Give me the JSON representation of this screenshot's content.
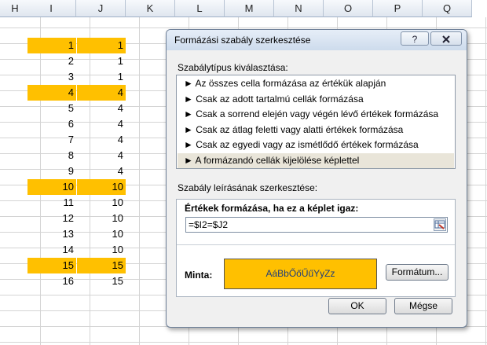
{
  "spreadsheet": {
    "columns": [
      "H",
      "I",
      "J",
      "K",
      "L",
      "M",
      "N",
      "O",
      "P",
      "Q"
    ],
    "rows": [
      {
        "i": "",
        "j": "",
        "highlight": false
      },
      {
        "i": "1",
        "j": "1",
        "highlight": true
      },
      {
        "i": "2",
        "j": "1",
        "highlight": false
      },
      {
        "i": "3",
        "j": "1",
        "highlight": false
      },
      {
        "i": "4",
        "j": "4",
        "highlight": true
      },
      {
        "i": "5",
        "j": "4",
        "highlight": false
      },
      {
        "i": "6",
        "j": "4",
        "highlight": false
      },
      {
        "i": "7",
        "j": "4",
        "highlight": false
      },
      {
        "i": "8",
        "j": "4",
        "highlight": false
      },
      {
        "i": "9",
        "j": "4",
        "highlight": false
      },
      {
        "i": "10",
        "j": "10",
        "highlight": true
      },
      {
        "i": "11",
        "j": "10",
        "highlight": false
      },
      {
        "i": "12",
        "j": "10",
        "highlight": false
      },
      {
        "i": "13",
        "j": "10",
        "highlight": false
      },
      {
        "i": "14",
        "j": "10",
        "highlight": false
      },
      {
        "i": "15",
        "j": "15",
        "highlight": true
      },
      {
        "i": "16",
        "j": "15",
        "highlight": false
      }
    ],
    "highlight_color": "#ffc000"
  },
  "dialog": {
    "title": "Formázási szabály szerkesztése",
    "help_label": "?",
    "close_label": "X",
    "rule_type_label": "Szabálytípus kiválasztása:",
    "rule_types": [
      "► Az összes cella formázása az értékük alapján",
      "► Csak az adott tartalmú cellák formázása",
      "► Csak a sorrend elején vagy végén lévő értékek formázása",
      "► Csak az átlag feletti vagy alatti értékek formázása",
      "► Csak az egyedi vagy az ismétlődő értékek formázása",
      "► A formázandó cellák kijelölése képlettel"
    ],
    "selected_rule_index": 5,
    "description_label": "Szabály leírásának szerkesztése:",
    "formula_label": "Értékek formázása, ha ez a képlet igaz:",
    "formula_value": "=$I2=$J2",
    "preview_label": "Minta:",
    "preview_text": "AáBbŐőŰűYyZz",
    "format_button": "Formátum...",
    "ok_button": "OK",
    "cancel_button": "Mégse"
  }
}
